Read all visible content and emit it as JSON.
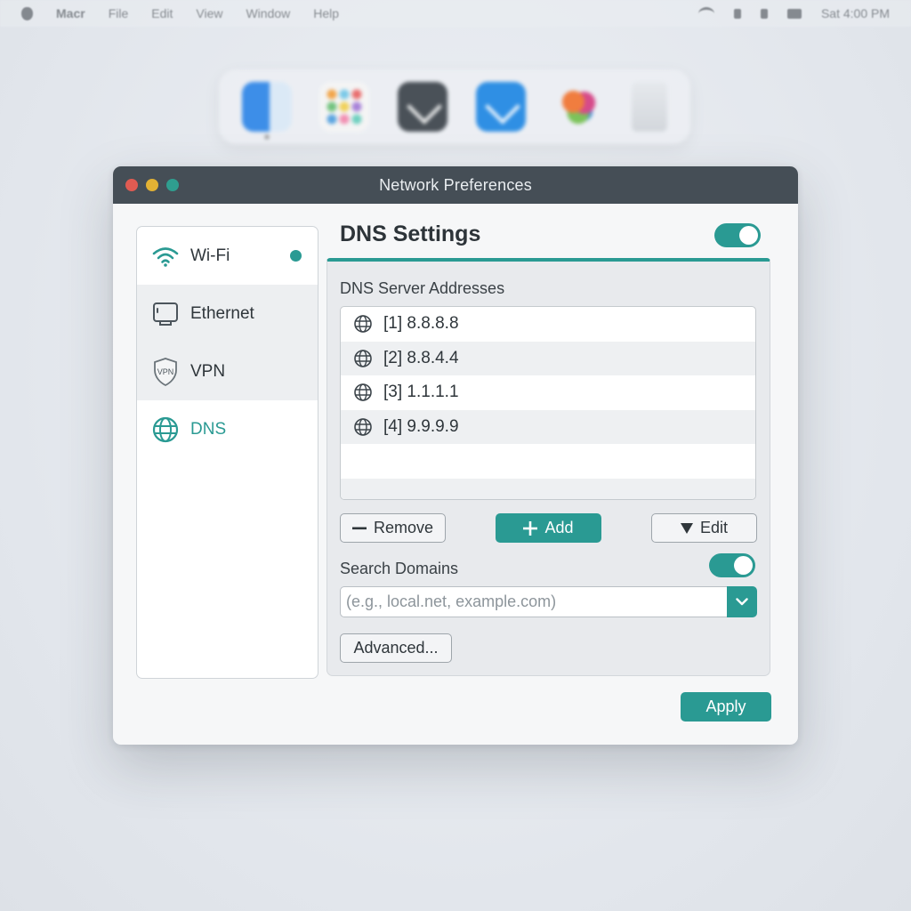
{
  "menubar": {
    "app_name": "Macr",
    "menus": [
      "File",
      "Edit",
      "View",
      "Window",
      "Help"
    ],
    "clock": "Sat 4:00 PM"
  },
  "window": {
    "title": "Network Preferences"
  },
  "sidebar": {
    "items": [
      {
        "label": "Wi-Fi",
        "icon": "wifi-icon"
      },
      {
        "label": "Ethernet",
        "icon": "ethernet-icon"
      },
      {
        "label": "VPN",
        "icon": "vpn-shield-icon",
        "icon_text": "VPN"
      },
      {
        "label": "DNS",
        "icon": "globe-icon"
      }
    ]
  },
  "dns": {
    "title": "DNS Settings",
    "enabled": true,
    "servers_label": "DNS Server Addresses",
    "servers": [
      "[1] 8.8.8.8",
      "[2] 8.8.4.4",
      "[3] 1.1.1.1",
      "[4] 9.9.9.9"
    ],
    "remove_label": "Remove",
    "add_label": "Add",
    "edit_label": "Edit",
    "search_domains_label": "Search Domains",
    "search_domains_enabled": true,
    "search_placeholder": "(e.g., local.net, example.com)",
    "advanced_label": "Advanced...",
    "apply_label": "Apply"
  },
  "colors": {
    "accent": "#2a9a93",
    "titlebar": "#454e56",
    "close": "#e05b52",
    "minimize": "#e2b234",
    "zoom": "#2f9e8f"
  }
}
